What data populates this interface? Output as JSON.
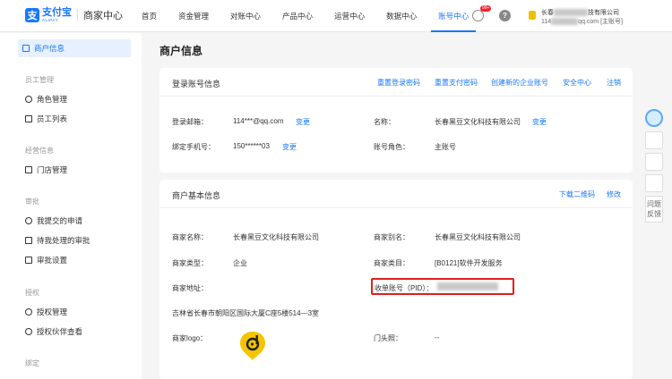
{
  "header": {
    "logo_mark": "支",
    "logo_cn": "支付宝",
    "logo_en": "ALIPAY",
    "logo_title": "商家中心",
    "nav": [
      {
        "label": "首页",
        "active": false
      },
      {
        "label": "资金管理",
        "active": false
      },
      {
        "label": "对账中心",
        "active": false
      },
      {
        "label": "产品中心",
        "active": false
      },
      {
        "label": "运营中心",
        "active": false
      },
      {
        "label": "数据中心",
        "active": false
      },
      {
        "label": "账号中心",
        "active": true
      }
    ],
    "badge": "99+",
    "help": "?",
    "user_name_suffix": "技有限公司",
    "user_email_prefix": "114",
    "user_email_suffix": "qq.com [主账号]"
  },
  "sidebar": {
    "items": [
      {
        "label": "商户信息",
        "active": true,
        "group": ""
      },
      {
        "label": "员工管理",
        "group_label": true
      },
      {
        "label": "角色管理"
      },
      {
        "label": "员工列表"
      },
      {
        "label": "经营信息",
        "group_label": true
      },
      {
        "label": "门店管理"
      },
      {
        "label": "审批",
        "group_label": true
      },
      {
        "label": "我提交的申请"
      },
      {
        "label": "待我处理的审批"
      },
      {
        "label": "审批设置"
      },
      {
        "label": "授权",
        "group_label": true
      },
      {
        "label": "授权管理"
      },
      {
        "label": "授权伙伴查看"
      },
      {
        "label": "绑定",
        "group_label": true
      }
    ]
  },
  "main": {
    "page_title": "商户信息",
    "login_card": {
      "title": "登录账号信息",
      "links": [
        "重置登录密码",
        "重置支付密码",
        "创建新的企业账号",
        "安全中心",
        "注销"
      ],
      "email_label": "登录邮箱：",
      "email_value": "114***@qq.com",
      "email_change": "变更",
      "name_label": "名称：",
      "name_value": "长春黑豆文化科技有限公司",
      "name_change": "变更",
      "phone_label": "绑定手机号：",
      "phone_value": "150******03",
      "phone_change": "变更",
      "role_label": "账号角色：",
      "role_value": "主账号"
    },
    "merchant_card": {
      "title": "商户基本信息",
      "links": [
        "下载二维码",
        "修改"
      ],
      "merchant_name_label": "商家名称：",
      "merchant_name_value": "长春黑豆文化科技有限公司",
      "alias_label": "商家别名：",
      "alias_value": "长春黑豆文化科技有限公司",
      "type_label": "商家类型：",
      "type_value": "企业",
      "category_label": "商家类目：",
      "category_value": "[B0121]软件开发服务",
      "address_label": "商家地址：",
      "pid_label": "收单账号（PID）：",
      "address_value": "吉林省长春市朝阳区国际大厦C座5楼514—3室",
      "logo_label": "商家logo：",
      "shopfront_label": "门头照：",
      "shopfront_value": "--"
    }
  },
  "tools": {
    "feedback": "问题反馈"
  },
  "colors": {
    "accent": "#1677ff",
    "highlight_border": "#e01e1e",
    "logo_yellow": "#f5c400"
  }
}
